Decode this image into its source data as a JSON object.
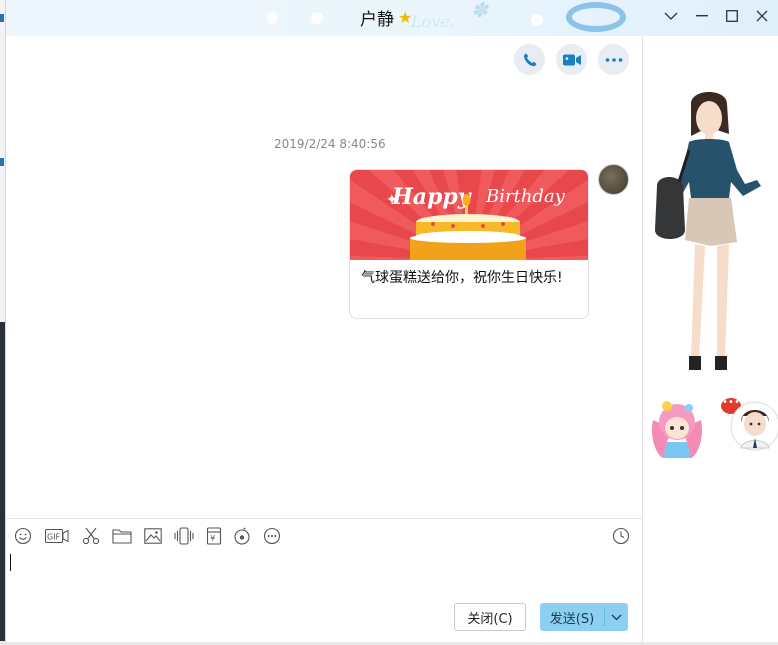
{
  "window": {
    "title": "户静",
    "title_icon": "star-icon",
    "controls": [
      "chevron-down-icon",
      "minimize-icon",
      "maximize-icon",
      "close-icon"
    ]
  },
  "header_actions": [
    {
      "name": "voice-call-button",
      "icon": "phone-icon"
    },
    {
      "name": "video-call-button",
      "icon": "video-icon"
    },
    {
      "name": "more-button",
      "icon": "more-icon"
    }
  ],
  "chat": {
    "timestamp": "2019/2/24 8:40:56",
    "message": {
      "banner_happy": "Happy",
      "banner_birthday": "Birthday",
      "text": "气球蛋糕送给你，祝你生日快乐!"
    }
  },
  "toolbar": {
    "gif_label": "GIF",
    "icons": [
      "emoji-icon",
      "gif-icon",
      "scissors-icon",
      "folder-icon",
      "image-icon",
      "shake-icon",
      "red-packet-icon",
      "music-icon",
      "more-icon",
      "history-icon"
    ]
  },
  "buttons": {
    "close_label": "关闭(C)",
    "send_label": "发送(S)"
  },
  "colors": {
    "accent": "#8dcff1",
    "icon": "#1b7fc1",
    "banner_red": "#ee4f52"
  }
}
